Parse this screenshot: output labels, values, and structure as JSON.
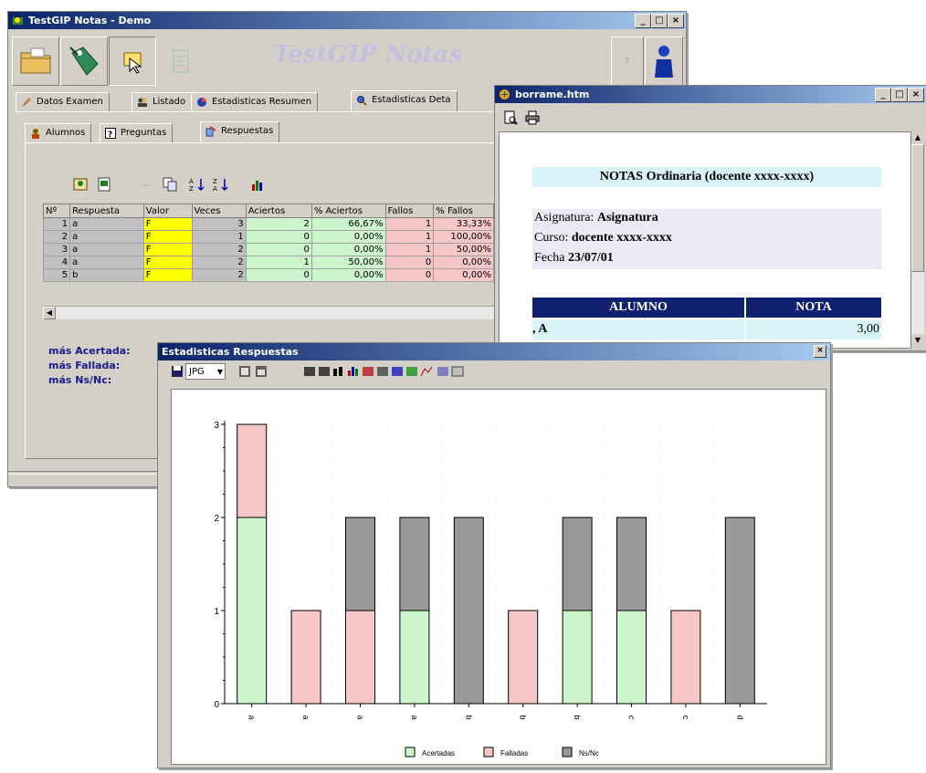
{
  "main_window": {
    "title": "TestGIP Notas - Demo",
    "watermark": "TestGIP Notas",
    "tabs": [
      "Datos Examen",
      "Listado",
      "Estadisticas Resumen",
      "Estadisticas Deta"
    ],
    "subtabs": [
      "Alumnos",
      "Preguntas",
      "Respuestas"
    ],
    "grid": {
      "headers": [
        "Nº",
        "Respuesta",
        "Valor",
        "Veces",
        "Aciertos",
        "% Aciertos",
        "Fallos",
        "% Fallos"
      ],
      "rows": [
        [
          "1",
          "a",
          "F",
          "3",
          "2",
          "66,67%",
          "1",
          "33,33%"
        ],
        [
          "2",
          "a",
          "F",
          "1",
          "0",
          "0,00%",
          "1",
          "100,00%"
        ],
        [
          "3",
          "a",
          "F",
          "2",
          "0",
          "0,00%",
          "1",
          "50,00%"
        ],
        [
          "4",
          "a",
          "F",
          "2",
          "1",
          "50,00%",
          "0",
          "0,00%"
        ],
        [
          "5",
          "b",
          "F",
          "2",
          "0",
          "0,00%",
          "0",
          "0,00%"
        ]
      ]
    },
    "stats": {
      "mas_acertada": "más Acertada:",
      "mas_fallada": "más Fallada:",
      "mas_nsnc": "más Ns/Nc:"
    }
  },
  "html_window": {
    "title": "borrame.htm",
    "heading": "NOTAS Ordinaria (docente xxxx-xxxx)",
    "asignatura_label": "Asignatura:",
    "asignatura_value": "Asignatura",
    "curso_label": "Curso:",
    "curso_value": "docente xxxx-xxxx",
    "fecha_label": "Fecha",
    "fecha_value": "23/07/01",
    "col_alumno": "ALUMNO",
    "col_nota": "NOTA",
    "row_alumno": ", A",
    "row_nota": "3,00"
  },
  "chart_window": {
    "title": "Estadisticas Respuestas",
    "format": "JPG"
  },
  "chart_data": {
    "type": "bar",
    "stacked": true,
    "categories": [
      "a",
      "a",
      "a",
      "a",
      "b",
      "b",
      "b",
      "c",
      "c",
      "d"
    ],
    "series": [
      {
        "name": "Acertadas",
        "color": "#ccf5cc",
        "values": [
          2,
          0,
          0,
          1,
          0,
          0,
          1,
          1,
          0,
          0
        ]
      },
      {
        "name": "Falladas",
        "color": "#f7c6c6",
        "values": [
          1,
          1,
          1,
          0,
          0,
          1,
          0,
          0,
          1,
          0
        ]
      },
      {
        "name": "Ns/Nc",
        "color": "#999999",
        "values": [
          0,
          0,
          1,
          1,
          2,
          0,
          1,
          1,
          0,
          2
        ]
      }
    ],
    "y_ticks": [
      "0",
      "1",
      "2",
      "3"
    ],
    "ylim": [
      0,
      3
    ],
    "legend_position": "bottom",
    "grid": false
  }
}
